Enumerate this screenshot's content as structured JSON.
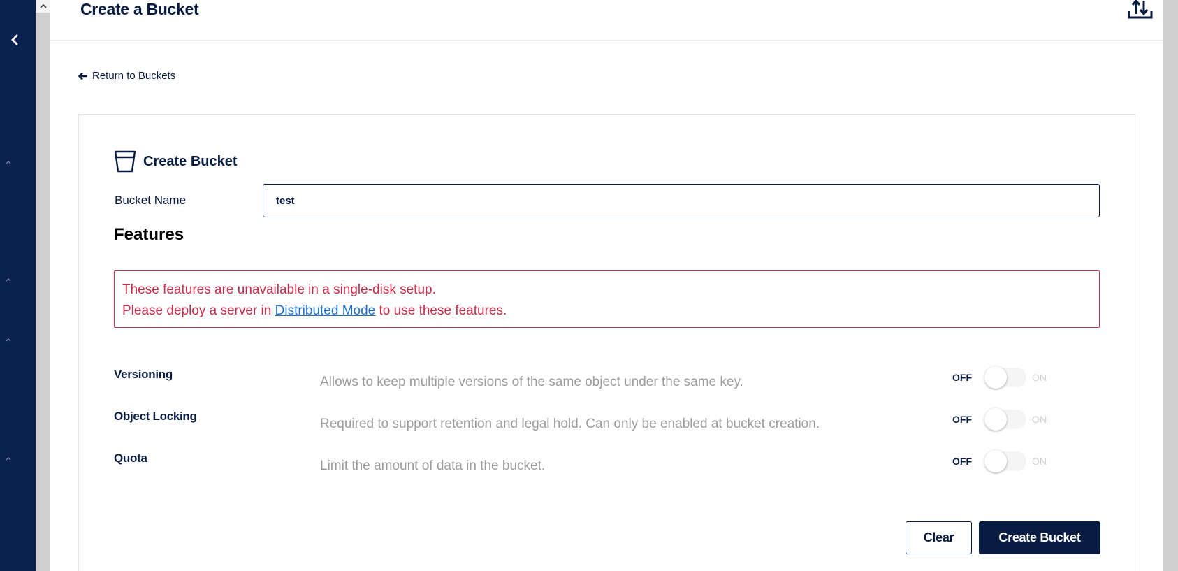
{
  "header": {
    "title": "Create a Bucket",
    "upload_icon": "upload-icon"
  },
  "sidebar": {
    "collapse_icon": "chevron-left-icon"
  },
  "main": {
    "back_link": "Return to Buckets",
    "card": {
      "title": "Create Bucket",
      "bucket_name_label": "Bucket Name",
      "bucket_name_value": "test",
      "features_title": "Features",
      "alert": {
        "line1": "These features are unavailable in a single-disk setup.",
        "line2_prefix": "Please deploy a server in ",
        "line2_link": "Distributed Mode",
        "line2_suffix": " to use these features."
      },
      "features": [
        {
          "name": "Versioning",
          "description": "Allows to keep multiple versions of the same object under the same key.",
          "off_label": "OFF",
          "on_label": "ON",
          "enabled": false
        },
        {
          "name": "Object Locking",
          "description": "Required to support retention and legal hold. Can only be enabled at bucket creation.",
          "off_label": "OFF",
          "on_label": "ON",
          "enabled": false
        },
        {
          "name": "Quota",
          "description": "Limit the amount of data in the bucket.",
          "off_label": "OFF",
          "on_label": "ON",
          "enabled": false
        }
      ],
      "clear_label": "Clear",
      "create_label": "Create Bucket"
    }
  },
  "colors": {
    "brand_navy": "#081c42",
    "sidebar": "#0b2150",
    "alert_red": "#c72c48",
    "link_blue": "#1c6fd0"
  }
}
